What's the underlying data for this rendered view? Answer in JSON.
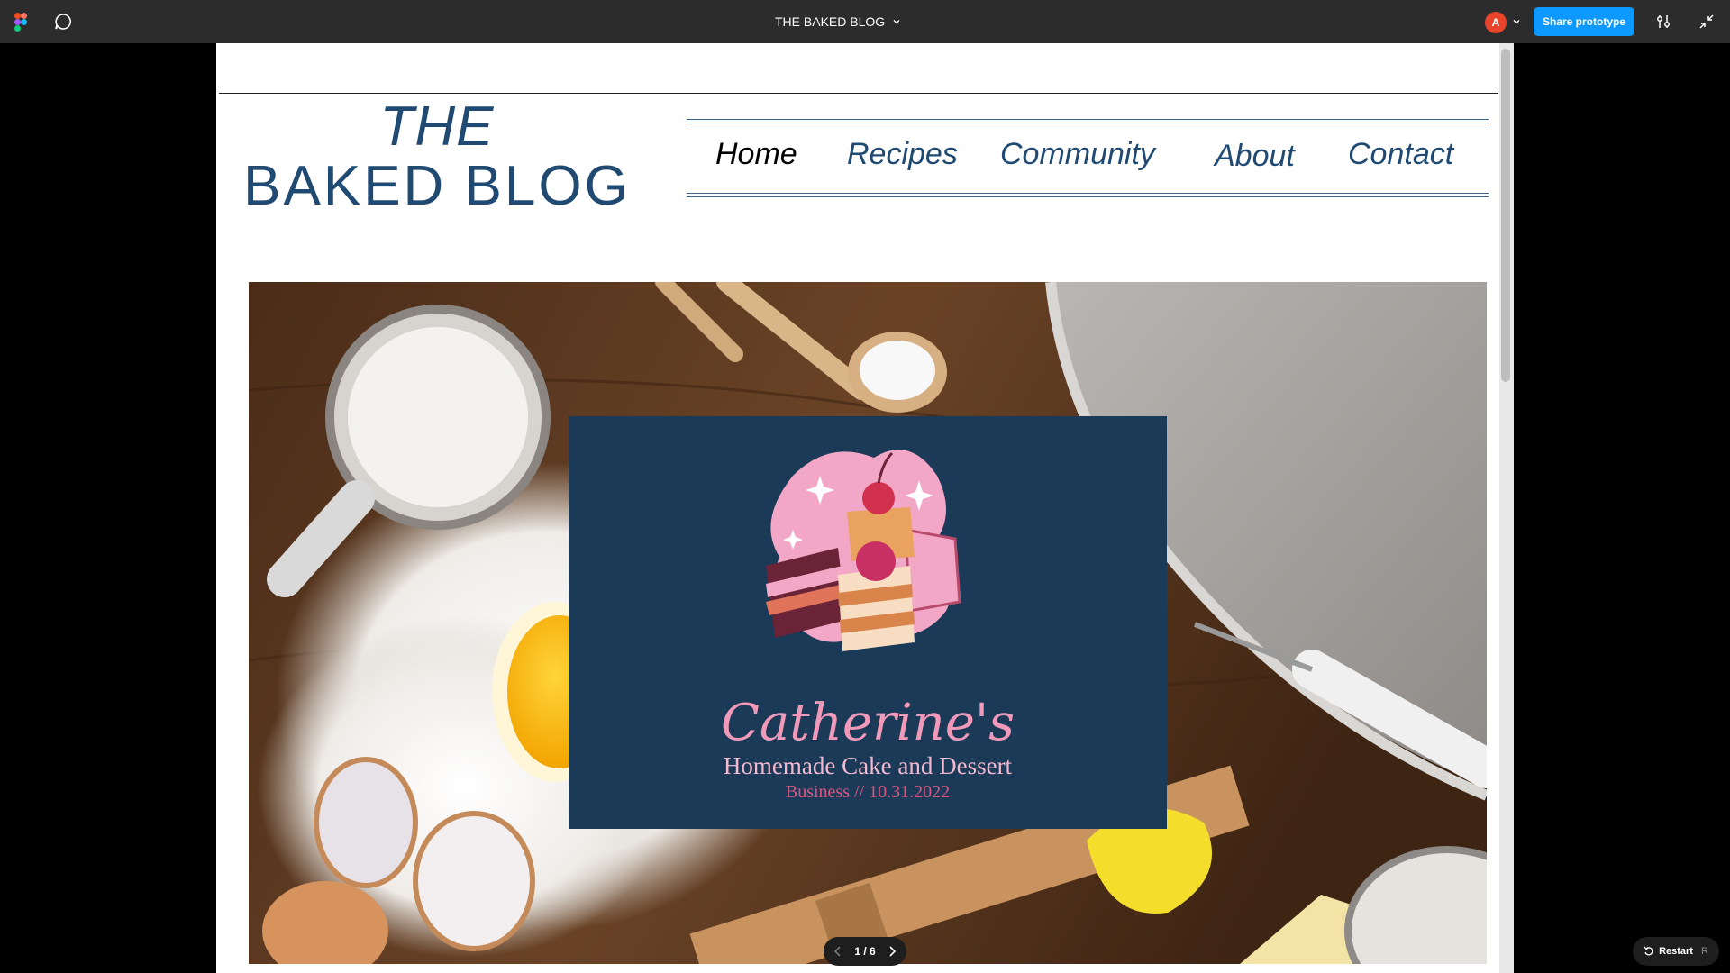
{
  "toolbar": {
    "title": "THE BAKED BLOG",
    "avatar_initial": "A",
    "share_label": "Share prototype",
    "icons": [
      "figma-logo-icon",
      "comment-icon",
      "chevron-down-icon",
      "settings-sliders-icon",
      "collapse-icon"
    ]
  },
  "header": {
    "logo_line1": "THE",
    "logo_line2": "BAKED BLOG"
  },
  "nav": {
    "items": [
      {
        "label": "Home",
        "active": true
      },
      {
        "label": "Recipes",
        "active": false
      },
      {
        "label": "Community",
        "active": false
      },
      {
        "label": "About",
        "active": false
      },
      {
        "label": "Contact",
        "active": false
      }
    ]
  },
  "hero": {
    "card_title": "Catherine's",
    "card_subtitle": "Homemade Cake and Dessert",
    "card_tagline": "Business // 10.31.2022"
  },
  "pager": {
    "label": "1 / 6"
  },
  "restart": {
    "label": "Restart",
    "shortcut": "R"
  },
  "colors": {
    "toolbar_bg": "#2c2c2c",
    "share_button": "#0d99ff",
    "brand_blue": "#204a72",
    "card_bg": "#1a3a58",
    "card_pink": "#f199b9"
  }
}
